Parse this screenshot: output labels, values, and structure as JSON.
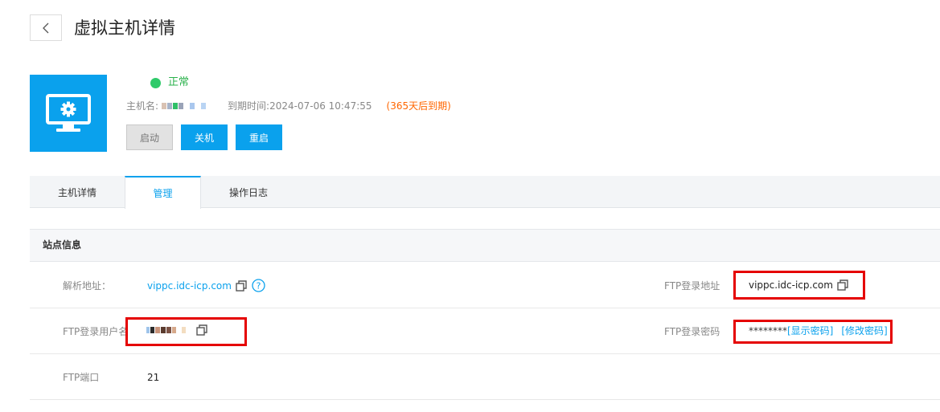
{
  "header": {
    "title": "虚拟主机详情"
  },
  "host": {
    "status": "正常",
    "hostname_label": "主机名:",
    "expire_label": "到期时间:",
    "expire_value": "2024-07-06 10:47:55",
    "expire_note": "(365天后到期)",
    "colors": {
      "accent": "#0aa1ed",
      "status_ok": "#2fca6a",
      "warn": "#ff6600"
    }
  },
  "actions": {
    "start": "启动",
    "stop": "关机",
    "restart": "重启"
  },
  "tabs": [
    {
      "label": "主机详情",
      "active": false
    },
    {
      "label": "管理",
      "active": true
    },
    {
      "label": "操作日志",
      "active": false
    }
  ],
  "site": {
    "section_title": "站点信息",
    "resolve_label": "解析地址：",
    "resolve_value": "vippc.idc-icp.com",
    "ftp_user_label": "FTP登录用户名",
    "ftp_port_label": "FTP端口",
    "ftp_port_value": "21",
    "ftp_addr_label": "FTP登录地址",
    "ftp_addr_value": "vippc.idc-icp.com",
    "ftp_pass_label": "FTP登录密码",
    "ftp_pass_mask": "********",
    "show_pass": "[显示密码]",
    "change_pass": "[修改密码]"
  }
}
